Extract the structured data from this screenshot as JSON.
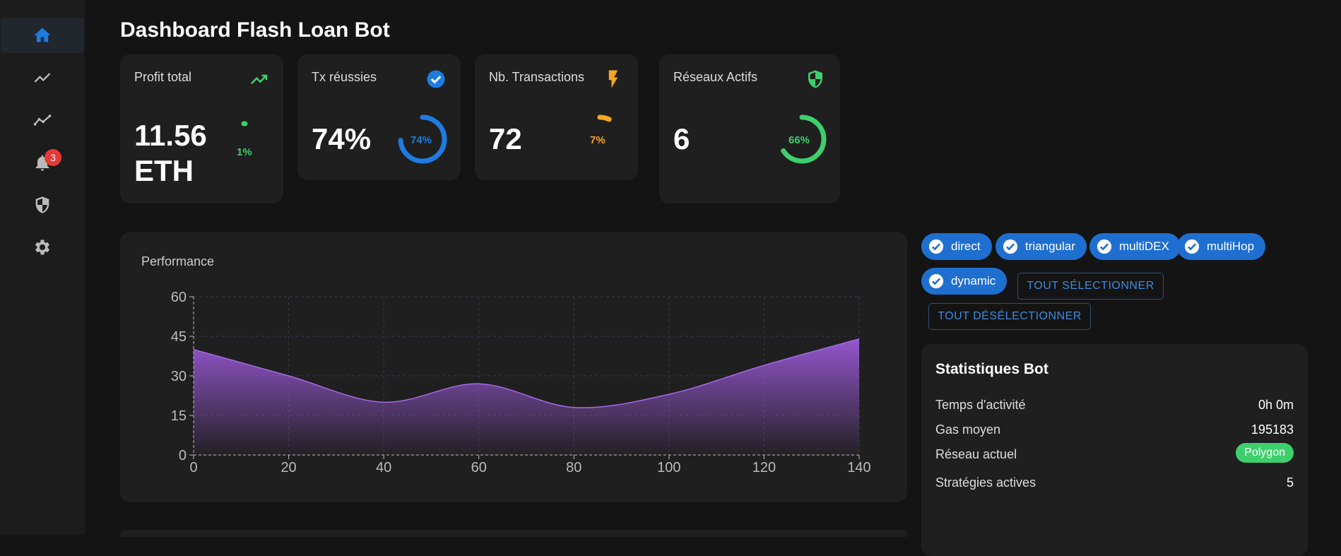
{
  "header": {
    "title": "Dashboard Flash Loan Bot"
  },
  "sidebar": {
    "items": [
      {
        "icon": "home-icon"
      },
      {
        "icon": "trending-up-icon"
      },
      {
        "icon": "timeline-icon"
      },
      {
        "icon": "bell-icon",
        "badge": "3"
      },
      {
        "icon": "security-icon"
      },
      {
        "icon": "gear-icon"
      }
    ]
  },
  "cards": {
    "profit": {
      "label": "Profit total",
      "value_line1": "11.56",
      "value_line2": "ETH",
      "ring_text": "1%",
      "ring_fraction": 0.01,
      "icon": "trending-up-icon"
    },
    "success": {
      "label": "Tx réussies",
      "value": "74%",
      "ring_text": "74%",
      "ring_fraction": 0.74,
      "icon": "check-circle-icon"
    },
    "transactions": {
      "label": "Nb. Transactions",
      "value": "72",
      "ring_text": "7%",
      "ring_fraction": 0.07,
      "icon": "bolt-icon"
    },
    "networks": {
      "label": "Réseaux Actifs",
      "value": "6",
      "ring_text": "66%",
      "ring_fraction": 0.66,
      "icon": "shield-icon"
    }
  },
  "colors": {
    "accent": "#1e6fd0",
    "success": "#3ecf6d",
    "warning": "#f5a623",
    "chart": "#9b59d8"
  },
  "chart": {
    "title": "Performance",
    "chart_data": {
      "type": "area",
      "x": [
        0,
        20,
        40,
        60,
        80,
        100,
        120,
        140
      ],
      "series": [
        {
          "values": [
            40,
            30,
            20,
            27,
            18,
            23,
            34,
            44
          ]
        }
      ],
      "x_ticks": [
        "0",
        "20",
        "40",
        "60",
        "80",
        "100",
        "120",
        "140"
      ],
      "y_ticks": [
        "0",
        "15",
        "30",
        "45",
        "60"
      ],
      "xlim": [
        0,
        140
      ],
      "ylim": [
        0,
        60
      ],
      "grid": true
    }
  },
  "strategies": {
    "chips": [
      {
        "label": "direct",
        "selected": true
      },
      {
        "label": "triangular",
        "selected": true
      },
      {
        "label": "multiDEX",
        "selected": true
      },
      {
        "label": "multiHop",
        "selected": true
      },
      {
        "label": "dynamic",
        "selected": true
      }
    ],
    "select_all": "TOUT SÉLECTIONNER",
    "deselect_all": "TOUT DÉSÉLECTIONNER"
  },
  "stats": {
    "title": "Statistiques Bot",
    "rows": [
      {
        "label": "Temps d'activité",
        "value": "0h 0m"
      },
      {
        "label": "Gas moyen",
        "value": "195183"
      },
      {
        "label": "Réseau actuel",
        "value": "Polygon"
      },
      {
        "label": "Stratégies actives",
        "value": "5"
      }
    ]
  }
}
